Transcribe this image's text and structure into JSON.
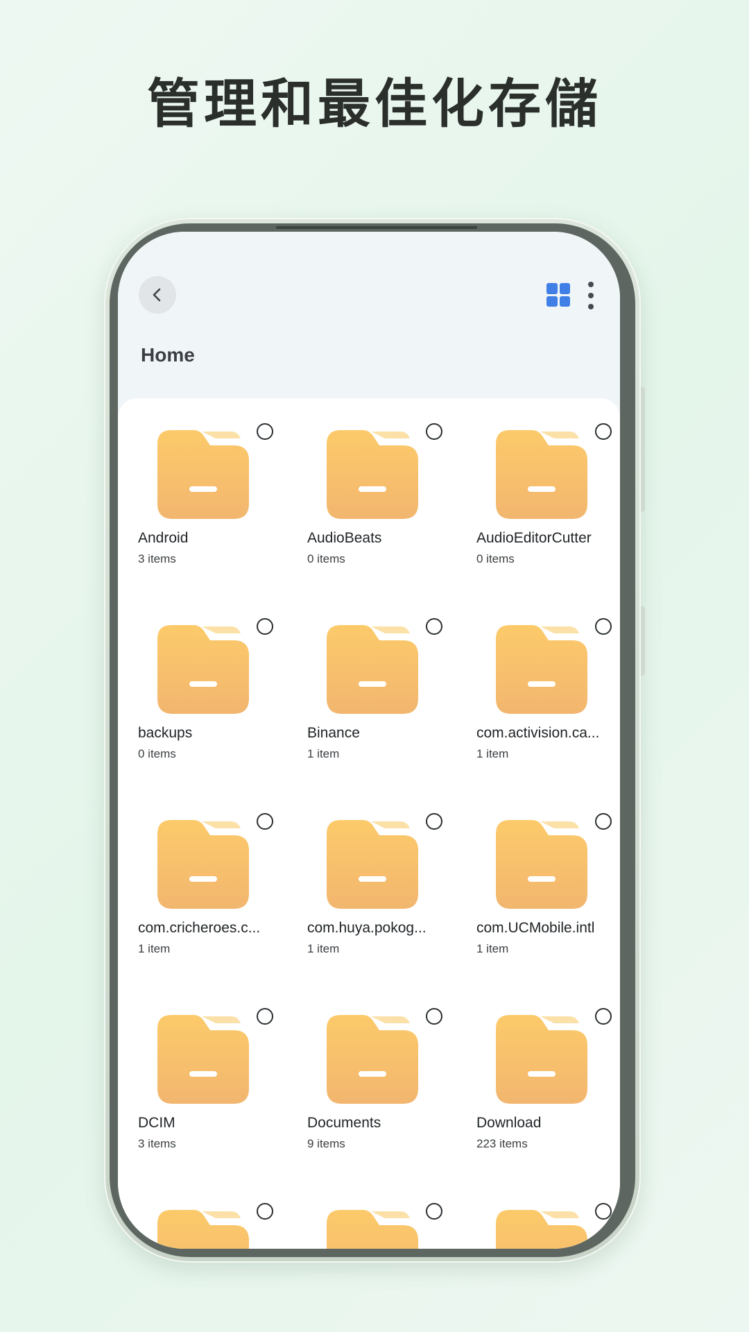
{
  "promo": {
    "headline": "管理和最佳化存儲"
  },
  "header": {
    "back_icon": "chevron-left-icon",
    "view_toggle_icon": "grid-view-icon",
    "more_icon": "more-vertical-icon",
    "title": "Home"
  },
  "colors": {
    "accent": "#3f7fe6",
    "folder_top": "#fcca6a",
    "folder_bottom": "#f2b66f",
    "folder_tab": "#fbe1a8",
    "background_mint": "#e4f5ea"
  },
  "folders": [
    {
      "name": "Android",
      "count": "3 items"
    },
    {
      "name": "AudioBeats",
      "count": "0 items"
    },
    {
      "name": "AudioEditorCutter",
      "count": "0 items"
    },
    {
      "name": "backups",
      "count": "0 items"
    },
    {
      "name": "Binance",
      "count": "1 item"
    },
    {
      "name": "com.activision.ca...",
      "count": "1 item"
    },
    {
      "name": "com.cricheroes.c...",
      "count": "1 item"
    },
    {
      "name": "com.huya.pokog...",
      "count": "1 item"
    },
    {
      "name": "com.UCMobile.intl",
      "count": "1 item"
    },
    {
      "name": "DCIM",
      "count": "3 items"
    },
    {
      "name": "Documents",
      "count": "9 items"
    },
    {
      "name": "Download",
      "count": "223 items"
    },
    {
      "name": "",
      "count": ""
    },
    {
      "name": "",
      "count": ""
    },
    {
      "name": "",
      "count": ""
    }
  ]
}
